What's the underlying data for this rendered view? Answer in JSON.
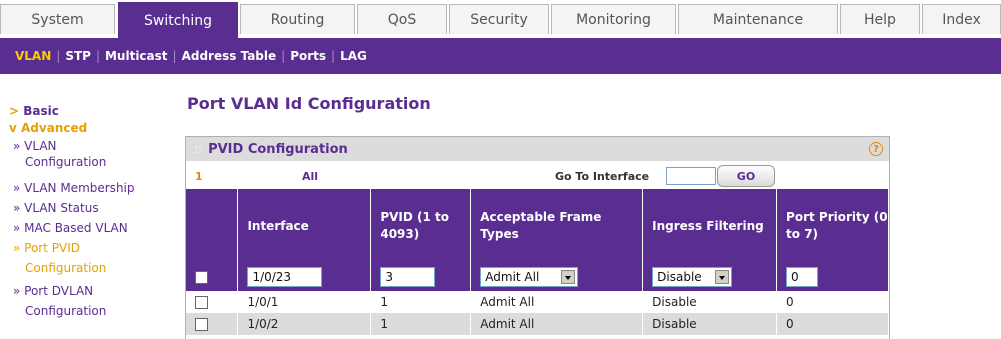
{
  "topnav": {
    "tabs": [
      {
        "label": "System",
        "active": false
      },
      {
        "label": "Switching",
        "active": true
      },
      {
        "label": "Routing",
        "active": false
      },
      {
        "label": "QoS",
        "active": false
      },
      {
        "label": "Security",
        "active": false
      },
      {
        "label": "Monitoring",
        "active": false
      },
      {
        "label": "Maintenance",
        "active": false
      },
      {
        "label": "Help",
        "active": false
      },
      {
        "label": "Index",
        "active": false
      }
    ]
  },
  "subnav": {
    "items": [
      "VLAN",
      "STP",
      "Multicast",
      "Address Table",
      "Ports",
      "LAG"
    ],
    "active": "VLAN"
  },
  "sidebar": {
    "basic": "Basic",
    "advanced": "Advanced",
    "items": [
      {
        "label": "» VLAN",
        "cont": "Configuration"
      },
      {
        "label": "» VLAN Membership"
      },
      {
        "label": "» VLAN Status"
      },
      {
        "label": "» MAC Based VLAN"
      },
      {
        "label": "» Port PVID",
        "cont": "Configuration",
        "active": true
      },
      {
        "label": "» Port DVLAN",
        "cont": "Configuration"
      }
    ]
  },
  "page": {
    "title": "Port VLAN Id Configuration",
    "panel_title": "PVID Configuration",
    "help_glyph": "?",
    "pager": {
      "page": "1",
      "all": "All",
      "goto_label": "Go To Interface",
      "goto_value": "",
      "go_label": "GO"
    }
  },
  "table": {
    "headers": [
      "Interface",
      "PVID (1 to 4093)",
      "Acceptable Frame Types",
      "Ingress Filtering",
      "Port Priority (0 to 7)"
    ],
    "edit_row": {
      "interface": "1/0/23",
      "pvid": "3",
      "frame_types": "Admit All",
      "ingress": "Disable",
      "priority": "0"
    },
    "rows": [
      {
        "interface": "1/0/1",
        "pvid": "1",
        "frame_types": "Admit All",
        "ingress": "Disable",
        "priority": "0"
      },
      {
        "interface": "1/0/2",
        "pvid": "1",
        "frame_types": "Admit All",
        "ingress": "Disable",
        "priority": "0"
      }
    ]
  },
  "colors": {
    "brand": "#5a2d91",
    "accent": "#e8a000",
    "header_gray": "#dcdcdc"
  }
}
